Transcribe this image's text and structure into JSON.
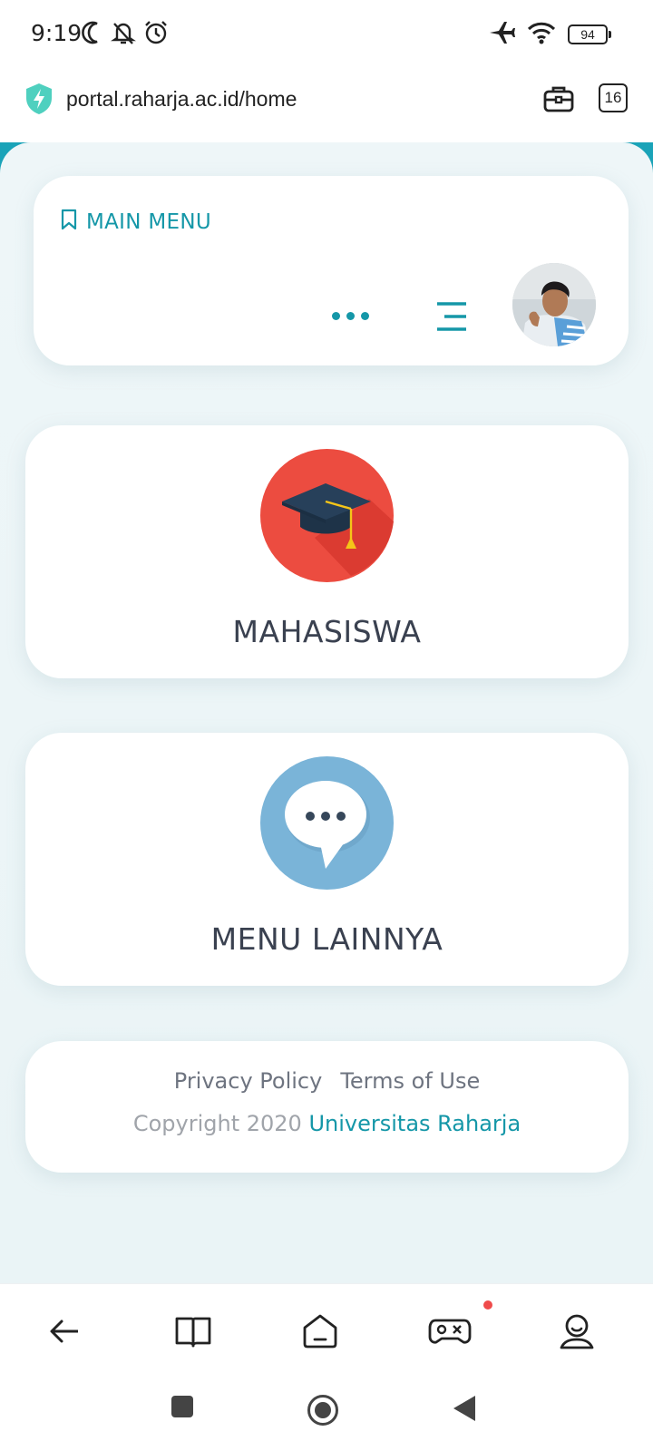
{
  "status_bar": {
    "time": "9:19",
    "battery": "94",
    "icons_left": [
      "moon-icon",
      "bell-off-icon",
      "alarm-icon"
    ],
    "icons_right": [
      "airplane-icon",
      "wifi-icon",
      "battery-icon"
    ]
  },
  "browser": {
    "url": "portal.raharja.ac.id/home",
    "tab_count": "16",
    "icons": [
      "shield-icon",
      "toolbox-icon",
      "tabs-icon"
    ]
  },
  "main_menu": {
    "title": "MAIN MENU",
    "icons": [
      "bookmark-icon",
      "more-dots-icon",
      "hamburger-icon"
    ]
  },
  "cards": [
    {
      "label": "MAHASISWA",
      "icon": "graduation-cap-icon"
    },
    {
      "label": "MENU LAINNYA",
      "icon": "chat-bubble-icon"
    }
  ],
  "footer": {
    "privacy_label": "Privacy Policy",
    "terms_label": "Terms of Use",
    "copyright_prefix": "Copyright 2020",
    "brand_name": "Universitas Raharja"
  },
  "bottom_nav": {
    "icons": [
      "back-arrow-icon",
      "book-icon",
      "home-icon",
      "gamepad-icon",
      "profile-icon"
    ]
  },
  "system_nav": {
    "icons": [
      "recents-icon",
      "home-circle-icon",
      "back-triangle-icon"
    ]
  },
  "colors": {
    "accent": "#1597a8",
    "page_bg": "#eaf4f6",
    "mahasiswa_circle": "#ec4c40",
    "lainnya_circle": "#7ab4d8",
    "notification": "#ef4b4b"
  }
}
